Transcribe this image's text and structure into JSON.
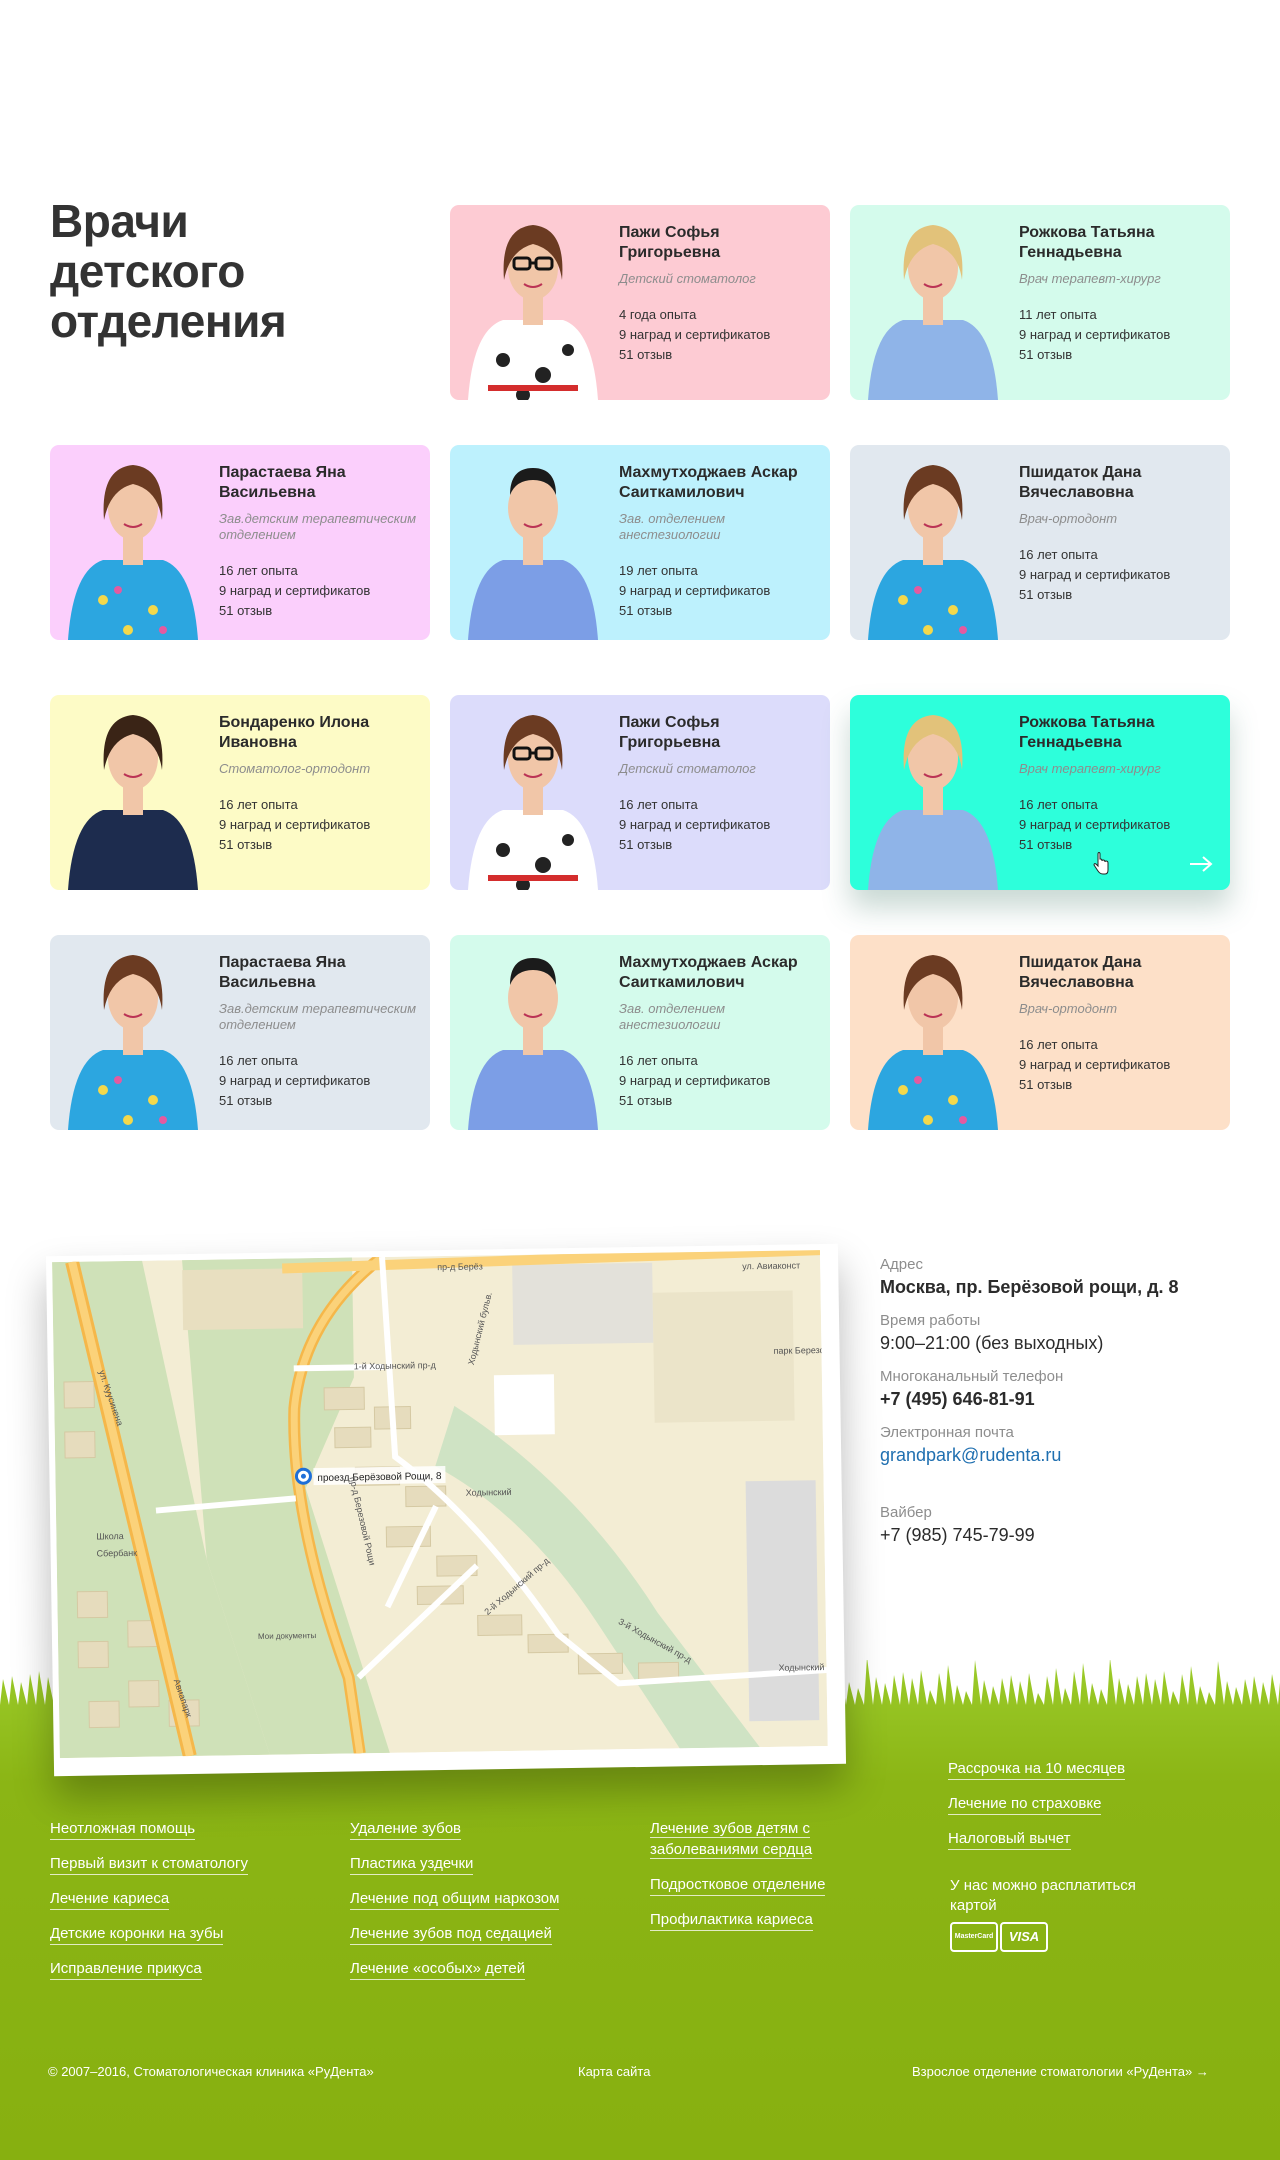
{
  "section_title": "Врачи детского отделения",
  "doctors": [
    {
      "name": "Пажи Софья Григорьевна",
      "specialty": "Детский стоматолог",
      "experience": "4 года опыта",
      "awards": "9 наград и сертификатов",
      "reviews": "51 отзыв",
      "bg": "#fdcbd3",
      "photo": "woman-glasses"
    },
    {
      "name": "Рожкова Татьяна Геннадьевна",
      "specialty": "Врач терапевт-хирург",
      "experience": "11 лет опыта",
      "awards": "9 наград и сертификатов",
      "reviews": "51 отзыв",
      "bg": "#d4fbec",
      "photo": "woman-blonde"
    },
    {
      "name": "Парастаева Яна Васильевна",
      "specialty": "Зав.детским терапевтическим отделением",
      "experience": "16 лет опыта",
      "awards": "9 наград и сертификатов",
      "reviews": "51 отзыв",
      "bg": "#fbcffc",
      "photo": "woman-print"
    },
    {
      "name": "Махмутходжаев Аскар Саиткамилович",
      "specialty": "Зав. отделением анестезиологии",
      "experience": "19 лет опыта",
      "awards": "9 наград и сертификатов",
      "reviews": "51 отзыв",
      "bg": "#bdf1fd",
      "photo": "man-blue"
    },
    {
      "name": "Пшидаток Дана Вячеславовна",
      "specialty": "Врач-ортодонт",
      "experience": "16 лет опыта",
      "awards": "9 наград и сертификатов",
      "reviews": "51 отзыв",
      "bg": "#e1e8ef",
      "photo": "woman-print"
    },
    {
      "name": "Бондаренко Илона Ивановна",
      "specialty": "Стоматолог-ортодонт",
      "experience": "16 лет опыта",
      "awards": "9 наград и сертификатов",
      "reviews": "51 отзыв",
      "bg": "#fdfbc6",
      "photo": "woman-navy"
    },
    {
      "name": "Пажи Софья Григорьевна",
      "specialty": "Детский стоматолог",
      "experience": "16 лет опыта",
      "awards": "9 наград и сертификатов",
      "reviews": "51 отзыв",
      "bg": "#dcdcfb",
      "photo": "woman-glasses"
    },
    {
      "name": "Рожкова Татьяна Геннадьевна",
      "specialty": "Врач терапевт-хирург",
      "experience": "16 лет опыта",
      "awards": "9 наград и сертификатов",
      "reviews": "51 отзыв",
      "bg": "#2dffdb",
      "photo": "woman-blonde",
      "hover": true
    },
    {
      "name": "Парастаева Яна Васильевна",
      "specialty": "Зав.детским терапевтическим отделением",
      "experience": "16 лет опыта",
      "awards": "9 наград и сертификатов",
      "reviews": "51 отзыв",
      "bg": "#e1e8ef",
      "photo": "woman-print"
    },
    {
      "name": "Махмутходжаев Аскар Саиткамилович",
      "specialty": "Зав. отделением анестезиологии",
      "experience": "16 лет опыта",
      "awards": "9 наград и сертификатов",
      "reviews": "51 отзыв",
      "bg": "#d4fbec",
      "photo": "man-blue"
    },
    {
      "name": "Пшидаток Дана Вячеславовна",
      "specialty": "Врач-ортодонт",
      "experience": "16 лет опыта",
      "awards": "9 наград и сертификатов",
      "reviews": "51 отзыв",
      "bg": "#fde0c8",
      "photo": "woman-print"
    }
  ],
  "map": {
    "marker_label": "проезд Берёзовой Рощи, 8",
    "labels": [
      "ул. Авиаконст",
      "пр-д Берёз",
      "1-й Ходынский пр-д",
      "Ходынский бульв.",
      "ул. Куусинена",
      "пр-д Березовой Рощи",
      "2-й Ходынский пр-д",
      "3-й Ходынский пр-д",
      "Ходынский бульв.",
      "Ходынский",
      "Школа",
      "Сбербанк",
      "Мои документы",
      "парк Березовая Роща",
      "Авиапарк",
      "ул. Куусинена"
    ]
  },
  "contact": {
    "address_label": "Адрес",
    "address": "Москва, пр. Берёзовой рощи, д. 8",
    "hours_label": "Время работы",
    "hours": "9:00–21:00 (без выходных)",
    "phone_label": "Многоканальный телефон",
    "phone": "+7 (495) 646-81-91",
    "email_label": "Электронная почта",
    "email": "grandpark@rudenta.ru",
    "viber_label": "Вайбер",
    "viber": "+7 (985) 745-79-99"
  },
  "footer": {
    "col1": [
      "Неотложная помощь",
      "Первый визит к стоматологу",
      "Лечение кариеса",
      "Детские коронки на зубы",
      "Исправление прикуса"
    ],
    "col2": [
      "Удаление зубов",
      "Пластика уздечки",
      "Лечение под общим наркозом",
      "Лечение зубов под седацией",
      "Лечение «особых» детей"
    ],
    "col3": [
      "Лечение зубов детям с заболеваниями сердца",
      "Подростковое отделение",
      "Профилактика кариеса"
    ],
    "col4": [
      "Рассрочка на 10 месяцев",
      "Лечение по страховке",
      "Налоговый вычет"
    ],
    "payment_text": "У нас можно расплатиться картой",
    "cards": [
      "MasterCard",
      "VISA"
    ],
    "copyright": "© 2007–2016, Стоматологическая клиника «РуДента»",
    "sitemap": "Карта сайта",
    "adult_link": "Взрослое отделение стоматологии «РуДента» →",
    "green": "#8ab510"
  }
}
